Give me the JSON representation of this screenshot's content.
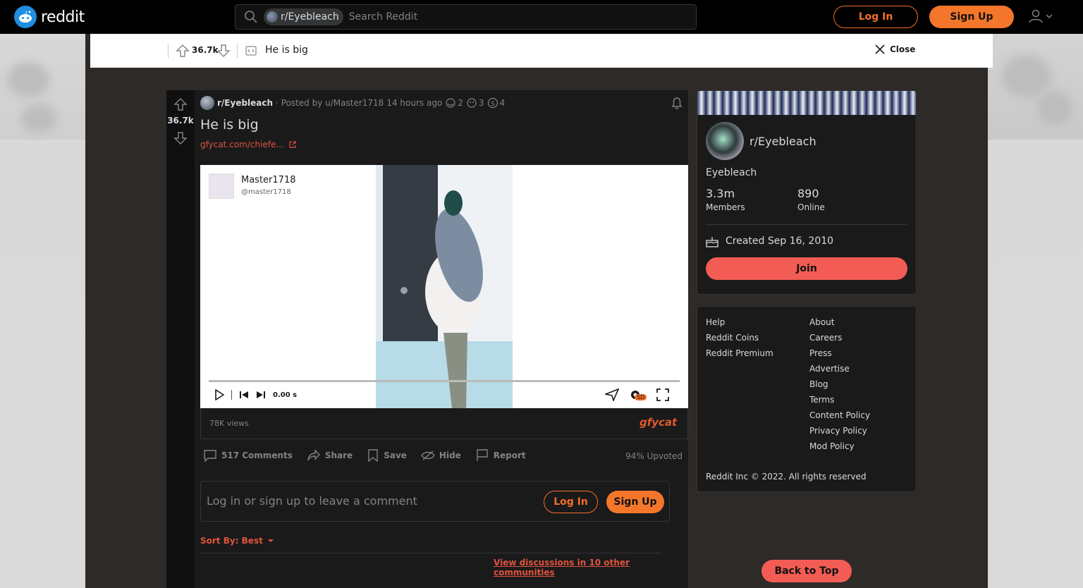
{
  "header": {
    "logo_text": "reddit",
    "search": {
      "chip_label": "r/Eyebleach",
      "placeholder": "Search Reddit"
    },
    "login_label": "Log In",
    "signup_label": "Sign Up"
  },
  "postbar": {
    "score": "36.7k",
    "title": "He is big",
    "close_label": "Close"
  },
  "post": {
    "score": "36.7k",
    "subreddit": "r/Eyebleach",
    "posted_by": "· Posted by u/Master1718",
    "time_ago": "14 hours ago",
    "awards": [
      {
        "icon": "award-hug-icon",
        "count": "2"
      },
      {
        "icon": "award-wholesome-icon",
        "count": "3"
      },
      {
        "icon": "award-silver-icon",
        "count": "4"
      }
    ],
    "title": "He is big",
    "link_text": "gfycat.com/chiefe...",
    "video": {
      "author_name": "Master1718",
      "author_handle": "@master1718",
      "time": "0.00 s",
      "quality": "SD",
      "views": "78K views",
      "provider": "gfycat"
    },
    "actions": {
      "comments": "517 Comments",
      "share": "Share",
      "save": "Save",
      "hide": "Hide",
      "report": "Report"
    },
    "upvoted": "94% Upvoted",
    "comment_box": {
      "placeholder": "Log in or sign up to leave a comment",
      "login_label": "Log In",
      "signup_label": "Sign Up"
    },
    "sort_by": "Sort By: Best",
    "other_discussions": "View discussions in 10 other communities"
  },
  "sidebar": {
    "name": "r/Eyebleach",
    "description": "Eyebleach",
    "members_value": "3.3m",
    "members_label": "Members",
    "online_value": "890",
    "online_label": "Online",
    "created": "Created Sep 16, 2010",
    "join_label": "Join"
  },
  "footer": {
    "col1": [
      "Help",
      "Reddit Coins",
      "Reddit Premium"
    ],
    "col2": [
      "About",
      "Careers",
      "Press",
      "Advertise",
      "Blog",
      "Terms",
      "Content Policy",
      "Privacy Policy",
      "Mod Policy"
    ],
    "copyright": "Reddit Inc © 2022. All rights reserved"
  },
  "back_to_top": "Back to Top",
  "colors": {
    "accent": "#f3762b",
    "link": "#e0533c",
    "join": "#f25c54"
  }
}
